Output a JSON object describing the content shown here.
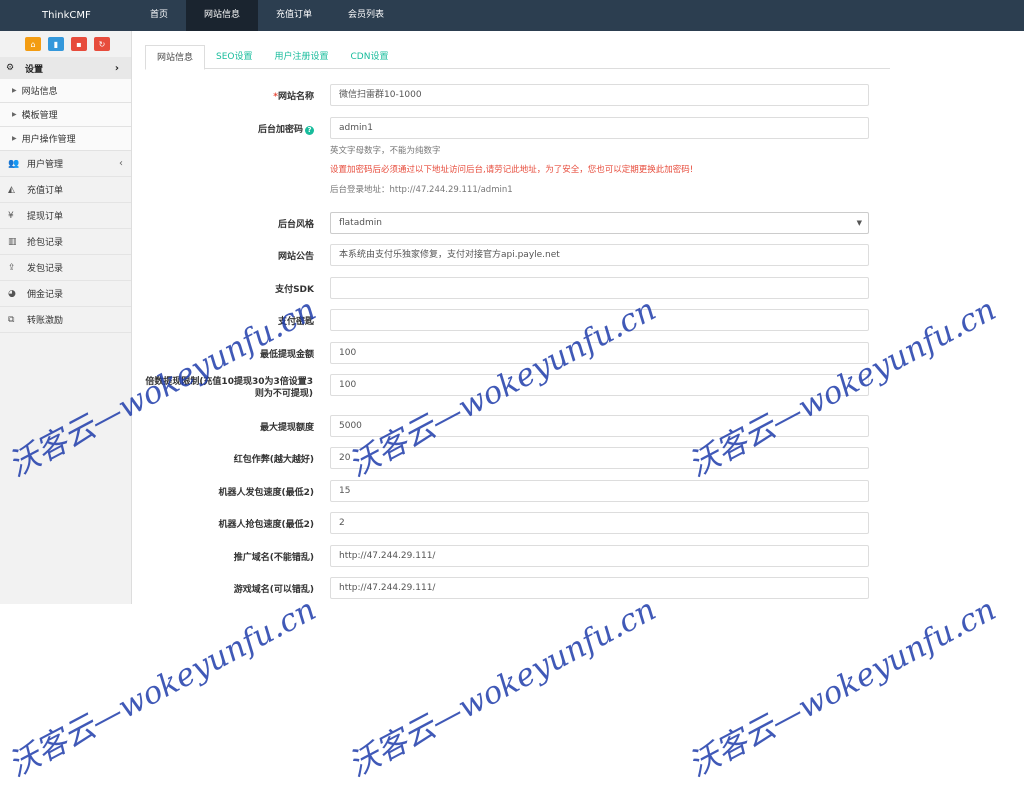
{
  "header": {
    "brand": "ThinkCMF",
    "nav": [
      {
        "label": "首页"
      },
      {
        "label": "网站信息",
        "active": true
      },
      {
        "label": "充值订单"
      },
      {
        "label": "会员列表"
      }
    ]
  },
  "sidebar": {
    "shortcuts": [
      {
        "icon": "home-icon",
        "glyph": "⌂",
        "color": "#f39c12"
      },
      {
        "icon": "file-icon",
        "glyph": "▮",
        "color": "#3498db"
      },
      {
        "icon": "trash-icon",
        "glyph": "▪",
        "color": "#e74c3c"
      },
      {
        "icon": "refresh-icon",
        "glyph": "↻",
        "color": "#e74c3c"
      }
    ],
    "group": {
      "label": "设置",
      "icon": "gears-icon",
      "glyph": "⚙",
      "arrow": "›"
    },
    "sub_items": [
      {
        "label": "网站信息"
      },
      {
        "label": "模板管理"
      },
      {
        "label": "用户操作管理"
      }
    ],
    "items": [
      {
        "label": "用户管理",
        "icon": "users-icon",
        "glyph": "👥",
        "arrow": "‹"
      },
      {
        "label": "充值订单",
        "icon": "area-chart-icon",
        "glyph": "◭"
      },
      {
        "label": "提现订单",
        "icon": "yen-icon",
        "glyph": "¥"
      },
      {
        "label": "抢包记录",
        "icon": "bar-chart-icon",
        "glyph": "▥"
      },
      {
        "label": "发包记录",
        "icon": "upload-icon",
        "glyph": "⇪"
      },
      {
        "label": "佣金记录",
        "icon": "pie-chart-icon",
        "glyph": "◕"
      },
      {
        "label": "转账激励",
        "icon": "transfer-icon",
        "glyph": "⧉"
      }
    ]
  },
  "tabs": [
    {
      "label": "网站信息",
      "active": true
    },
    {
      "label": "SEO设置"
    },
    {
      "label": "用户注册设置"
    },
    {
      "label": "CDN设置"
    }
  ],
  "form": {
    "site_name": {
      "label": "网站名称",
      "required_mark": "*",
      "value": "微信扫雷群10-1000"
    },
    "admin_code": {
      "label": "后台加密码",
      "help_icon": "?",
      "value": "admin1",
      "hint": "英文字母数字，不能为纯数字",
      "warning": "设置加密码后必须通过以下地址访问后台,请劳记此地址，为了安全，您也可以定期更换此加密码!",
      "login_address": "后台登录地址：http://47.244.29.111/admin1"
    },
    "admin_theme": {
      "label": "后台风格",
      "value": "flatadmin",
      "caret": "▼"
    },
    "notice": {
      "label": "网站公告",
      "value": "本系统由支付乐独家修复，支付对接官方api.payle.net"
    },
    "pay_sdk": {
      "label": "支付SDK",
      "value": ""
    },
    "pay_key": {
      "label": "支付密匙",
      "value": ""
    },
    "min_withdraw": {
      "label": "最低提现金额",
      "value": "100"
    },
    "multiplier": {
      "label": "倍数提现限制(充值10提现30为3倍设置3则为不可提现)",
      "value": "100"
    },
    "max_withdraw": {
      "label": "最大提现额度",
      "value": "5000"
    },
    "cheat": {
      "label": "红包作弊(越大越好)",
      "value": "20"
    },
    "robot_send": {
      "label": "机器人发包速度(最低2)",
      "value": "15"
    },
    "robot_grab": {
      "label": "机器人抢包速度(最低2)",
      "value": "2"
    },
    "promo_domain": {
      "label": "推广域名(不能错乱)",
      "value": "http://47.244.29.111/"
    },
    "game_domain": {
      "label": "游戏域名(可以错乱)",
      "value": "http://47.244.29.111/"
    }
  },
  "watermark": "沃客云—wokeyunfu.cn"
}
